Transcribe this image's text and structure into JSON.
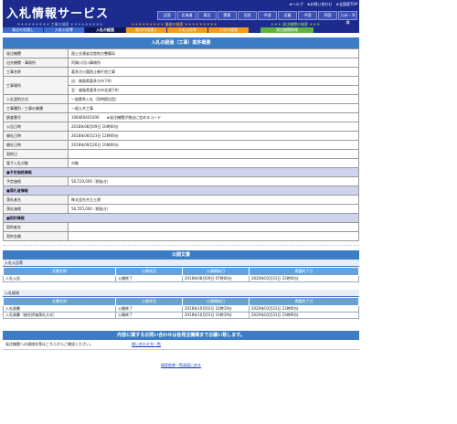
{
  "header": {
    "logo": "入札情報サービス",
    "links": [
      "★ヘルプ",
      "★お問い合わせ",
      "★全国版TOP"
    ],
    "regions": [
      "全国",
      "北海道",
      "東北",
      "関東",
      "北陸",
      "中部",
      "近畿",
      "中国",
      "四国",
      "九州・沖縄"
    ],
    "sys_groups": [
      "＊＊＊＊＊＊＊＊＊ 工事の検索 ＊＊＊＊＊＊＊＊＊",
      "＊＊＊＊＊＊＊＊＊ 業務の検索 ＊＊＊＊＊＊＊＊＊",
      "＊＊＊ 発注機関の検索 ＊＊＊"
    ],
    "tabs": [
      {
        "label": "発注の見通し",
        "style": "blue"
      },
      {
        "label": "入札公告等",
        "style": "blue"
      },
      {
        "label": "入札の経過",
        "style": "active"
      },
      {
        "label": "発注の見通し",
        "style": "orange"
      },
      {
        "label": "入札公告等",
        "style": "orange"
      },
      {
        "label": "入札の経過",
        "style": "orange"
      },
      {
        "label": "発注機関情報",
        "style": "green"
      }
    ]
  },
  "main": {
    "title": "入札の経過（工事）案件概要",
    "rows": [
      {
        "type": "row",
        "label": "発注機関",
        "value": "国土交通省北陸地方整備局"
      },
      {
        "type": "row",
        "label": "出先機関・事務所",
        "value": "阿賀川河川事務所"
      },
      {
        "type": "row",
        "label": "工事名称",
        "value": "喜多方小舘防止柵そ他工事"
      },
      {
        "type": "row2",
        "label": "工事場所",
        "value": "自：福島県喜多方市下町",
        "value2": "至：福島県喜多方市北浦下町"
      },
      {
        "type": "row",
        "label": "入札契約方式",
        "value": "一般競争入札（同時提出型）"
      },
      {
        "type": "row",
        "label": "工事種別／工事の業種",
        "value": "一般土木工事"
      },
      {
        "type": "row",
        "label": "調査番号",
        "value": "108460401006　　★発注機関が独自に定めるコード"
      },
      {
        "type": "row",
        "label": "公告日時",
        "value": "2018年08月09日 10時00分"
      },
      {
        "type": "row",
        "label": "開札日時",
        "value": "2018年08月23日 12時00分"
      },
      {
        "type": "row",
        "label": "開札日時",
        "value": "2018年09月26日 10時00分"
      },
      {
        "type": "row",
        "label": "契約日",
        "value": ""
      },
      {
        "type": "row",
        "label": "電子入札対象",
        "value": "対象"
      },
      {
        "type": "section",
        "label": "■予定価格情報"
      },
      {
        "type": "row",
        "label": "予定価格",
        "value": "56,510,000（税抜き）"
      },
      {
        "type": "section",
        "label": "■落札者情報"
      },
      {
        "type": "row",
        "label": "落札者名",
        "value": "株式会社共立土建"
      },
      {
        "type": "row",
        "label": "落札価格",
        "value": "56,555,000（税抜き）"
      },
      {
        "type": "section",
        "label": "■契約情報"
      },
      {
        "type": "row",
        "label": "契約者名",
        "value": ""
      },
      {
        "type": "row",
        "label": "契約金額",
        "value": ""
      }
    ]
  },
  "public_docs": {
    "title": "公開文書",
    "groups": [
      {
        "name": "入札公告等",
        "headers": [
          "文書名称",
          "公開状況",
          "公開開始日",
          "掲載終了日"
        ],
        "rows": [
          [
            "入札公告",
            "公開終了",
            "2018年08月09日 07時00分",
            "2020年03月31日 23時00分"
          ]
        ]
      },
      {
        "name": "入札経過",
        "headers": [
          "文書名称",
          "公開状況",
          "公開開始日",
          "掲載終了日"
        ],
        "rows": [
          [
            "入札調書",
            "公開終了",
            "2018年10月02日 10時19分",
            "2020年03月31日 23時00分"
          ],
          [
            "入札調書（総合評価落札方式）",
            "公開終了",
            "2018年10月03日 10時19分",
            "2020年03月31日 23時00分"
          ]
        ]
      }
    ]
  },
  "inquiry": {
    "title": "内容に関するお問い合わせは各発注機関までお願い致します。",
    "row_label": "発注機関への連絡先等はこちらからご確認ください。",
    "row_link": "問い合わせ先一覧"
  },
  "footer": {
    "back_link": "検索結果一覧画面に戻る"
  },
  "colors": {
    "header": "#1d2b8f",
    "title_bar": "#3b7cc4",
    "section": "#cfd3ee"
  }
}
